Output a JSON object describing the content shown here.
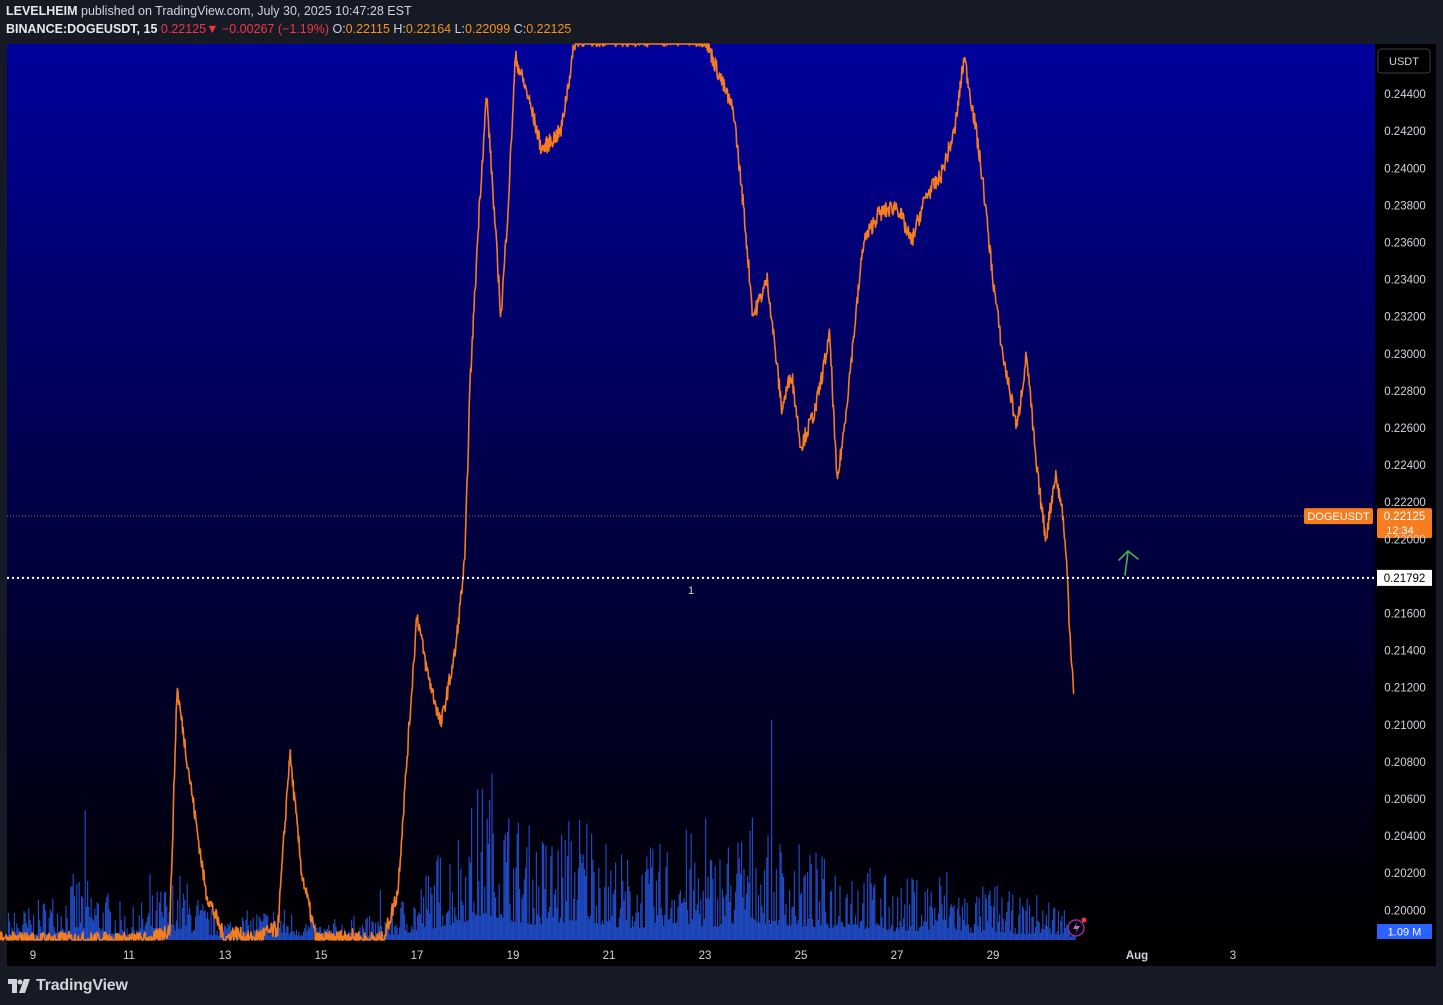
{
  "header": {
    "publisher": "LEVELHEIM",
    "published_text": "published on TradingView.com, July 30, 2025 10:47:28 EST",
    "symbol": "BINANCE:DOGEUSDT, 15",
    "last_price": "0.22125",
    "change_arrow": "▼",
    "change": "−0.00267 (−1.19%)",
    "o_label": "O:",
    "o_value": "0.22115",
    "h_label": "H:",
    "h_value": "0.22164",
    "l_label": "L:",
    "l_value": "0.22099",
    "c_label": "C:",
    "c_value": "0.22125"
  },
  "footer": {
    "brand": "TradingView",
    "logo_icon": "tradingview-logo-icon"
  },
  "colors": {
    "price_line": "#f57c1f",
    "volume": "#2962ff",
    "background_top": "#00009c",
    "background_bottom": "#000000",
    "price_tag": "#f57c1f",
    "arrow": "#4caf50"
  },
  "chart_data": {
    "type": "line",
    "symbol": "DOGEUSDT",
    "currency_button": "USDT",
    "y_ticks": [
      "0.24400",
      "0.24200",
      "0.24000",
      "0.23800",
      "0.23600",
      "0.23400",
      "0.23200",
      "0.23000",
      "0.22800",
      "0.22600",
      "0.22400",
      "0.22200",
      "0.22000",
      "0.21600",
      "0.21400",
      "0.21200",
      "0.21000",
      "0.20800",
      "0.20600",
      "0.20400",
      "0.20200",
      "0.20000"
    ],
    "ylim": [
      0.1984,
      0.2467
    ],
    "x_ticks": [
      {
        "label": "9",
        "day": 9
      },
      {
        "label": "11",
        "day": 11
      },
      {
        "label": "13",
        "day": 13
      },
      {
        "label": "15",
        "day": 15
      },
      {
        "label": "17",
        "day": 17
      },
      {
        "label": "19",
        "day": 19
      },
      {
        "label": "21",
        "day": 21
      },
      {
        "label": "23",
        "day": 23
      },
      {
        "label": "25",
        "day": 25
      },
      {
        "label": "27",
        "day": 27
      },
      {
        "label": "29",
        "day": 29
      },
      {
        "label": "Aug",
        "day": 32
      },
      {
        "label": "3",
        "day": 34
      }
    ],
    "price_series": {
      "day": [
        8.0,
        9.0,
        10.0,
        11.0,
        11.5,
        11.85,
        12.0,
        12.3,
        12.6,
        13.0,
        13.2,
        13.5,
        14.1,
        14.35,
        14.6,
        14.9,
        15.2,
        15.6,
        15.9,
        16.3,
        16.6,
        17.0,
        17.2,
        17.5,
        17.8,
        18.0,
        18.1,
        18.3,
        18.45,
        18.6,
        18.75,
        18.9,
        19.05,
        19.3,
        19.6,
        20.0,
        20.3,
        20.8,
        21.0,
        22.5,
        23.0,
        23.6,
        23.8,
        24.0,
        24.3,
        24.6,
        24.8,
        25.0,
        25.3,
        25.6,
        25.75,
        25.9,
        26.1,
        26.3,
        26.6,
        27.0,
        27.3,
        27.6,
        27.9,
        28.2,
        28.4,
        28.65,
        28.8,
        29.0,
        29.2,
        29.5,
        29.7,
        29.9,
        30.1,
        30.3,
        30.45,
        30.55,
        30.6,
        30.7
      ],
      "price": [
        0.1984,
        0.1984,
        0.1984,
        0.1984,
        0.1984,
        0.199,
        0.212,
        0.2065,
        0.201,
        0.1984,
        0.1988,
        0.1984,
        0.199,
        0.2085,
        0.202,
        0.1984,
        0.1984,
        0.1986,
        0.1984,
        0.1984,
        0.201,
        0.216,
        0.213,
        0.21,
        0.214,
        0.219,
        0.228,
        0.238,
        0.244,
        0.238,
        0.232,
        0.238,
        0.246,
        0.244,
        0.241,
        0.242,
        0.247,
        0.247,
        0.247,
        0.247,
        0.247,
        0.243,
        0.238,
        0.232,
        0.234,
        0.227,
        0.229,
        0.225,
        0.227,
        0.231,
        0.223,
        0.226,
        0.231,
        0.236,
        0.2375,
        0.238,
        0.236,
        0.2385,
        0.2395,
        0.242,
        0.246,
        0.242,
        0.239,
        0.234,
        0.23,
        0.226,
        0.23,
        0.224,
        0.22,
        0.2235,
        0.2215,
        0.218,
        0.215,
        0.21125
      ]
    },
    "volume_series": {
      "label": "1.09 M",
      "day": [
        8.0,
        9.0,
        10.0,
        11.0,
        11.5,
        12.0,
        12.6,
        13.0,
        13.5,
        14.0,
        14.5,
        15.0,
        15.5,
        16.0,
        16.5,
        17.0,
        17.5,
        18.0,
        18.5,
        19.0,
        19.5,
        20.0,
        20.5,
        21.0,
        21.5,
        22.0,
        22.5,
        23.0,
        23.5,
        24.0,
        24.5,
        25.0,
        25.5,
        26.0,
        26.5,
        27.0,
        27.5,
        28.0,
        28.5,
        29.0,
        29.5,
        30.0,
        30.5,
        30.7
      ],
      "level": [
        0.04,
        0.06,
        0.12,
        0.05,
        0.08,
        0.12,
        0.06,
        0.04,
        0.05,
        0.06,
        0.05,
        0.03,
        0.04,
        0.04,
        0.06,
        0.1,
        0.16,
        0.22,
        0.3,
        0.22,
        0.18,
        0.2,
        0.24,
        0.16,
        0.14,
        0.16,
        0.2,
        0.15,
        0.18,
        0.22,
        0.18,
        0.16,
        0.14,
        0.16,
        0.12,
        0.1,
        0.11,
        0.13,
        0.08,
        0.1,
        0.07,
        0.08,
        0.06,
        0.03
      ]
    },
    "current_price": {
      "label": "DOGEUSDT",
      "value": "0.22125",
      "countdown": "12:34"
    },
    "horizontal_level": {
      "value": "0.21792",
      "marker": "1"
    },
    "annotation": "up-arrow"
  }
}
